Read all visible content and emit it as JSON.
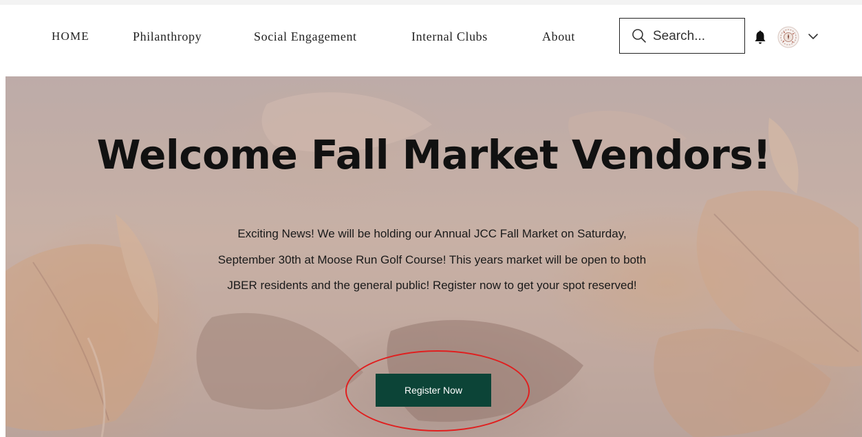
{
  "nav": {
    "items": [
      {
        "label": "HOME"
      },
      {
        "label": "Philanthropy"
      },
      {
        "label": "Social Engagement"
      },
      {
        "label": "Internal Clubs"
      },
      {
        "label": "About"
      }
    ]
  },
  "search": {
    "placeholder": "Search..."
  },
  "icons": {
    "search": "search-icon",
    "bell": "bell-icon",
    "avatar": "avatar",
    "chevron": "chevron-down-icon"
  },
  "hero": {
    "title": "Welcome Fall Market Vendors!",
    "paragraph": "Exciting News! We will be holding our Annual JCC Fall Market on Saturday, September 30th at Moose Run Golf Course! This years market will be open to both JBER residents and the general public! Register now to get your spot reserved!",
    "button_label": "Register Now"
  },
  "colors": {
    "button": "#0c4437",
    "annotation": "#e01f1f",
    "text": "#111111"
  }
}
